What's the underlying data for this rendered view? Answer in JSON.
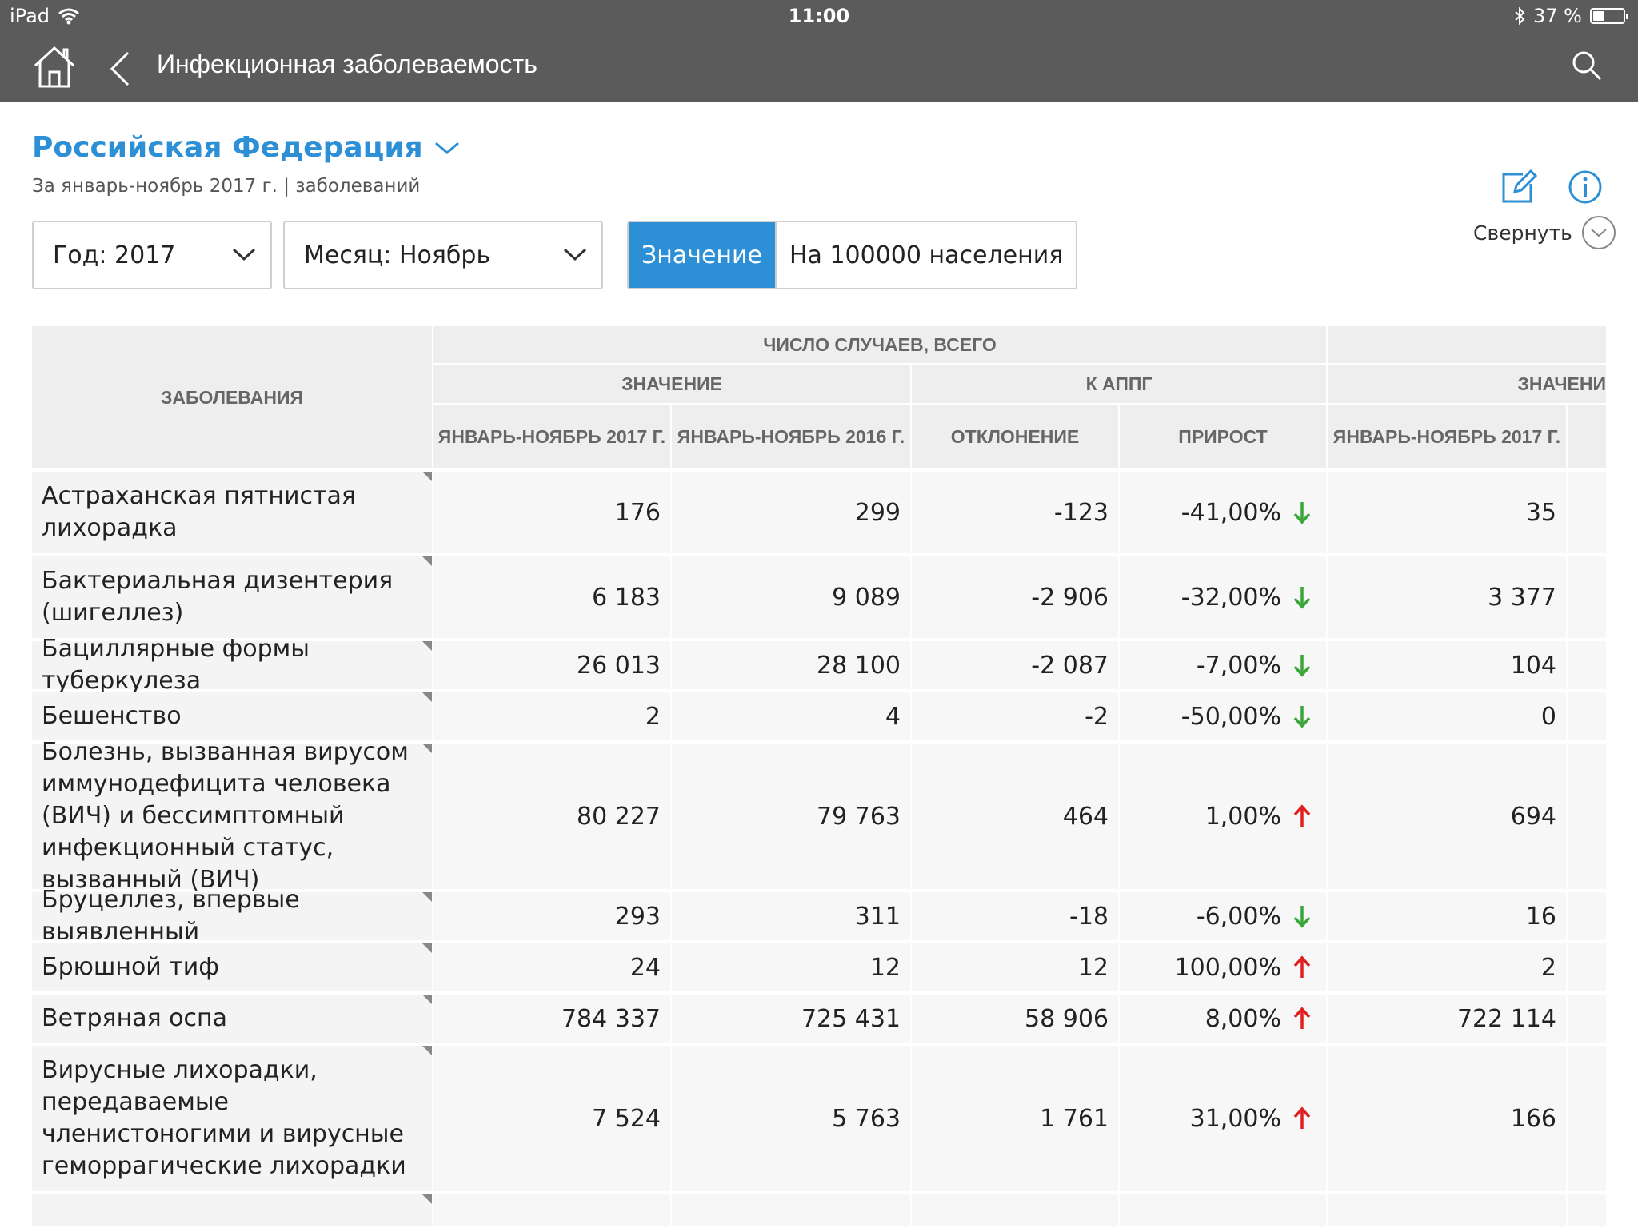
{
  "status_bar": {
    "device": "iPad",
    "time": "11:00",
    "battery": "37 %"
  },
  "nav": {
    "title": "Инфекционная заболеваемость"
  },
  "header": {
    "region": "Российская Федерация",
    "subtitle": "За январь-ноябрь 2017 г. | заболеваний",
    "collapse_label": "Свернуть"
  },
  "filters": {
    "year": "Год: 2017",
    "month": "Месяц: Ноябрь",
    "toggle_value": "Значение",
    "toggle_per100k": "На 100000 населения",
    "toggle_selected": "Значение"
  },
  "table": {
    "col_diseases": "ЗАБОЛЕВАНИЯ",
    "group_total": "ЧИСЛО СЛУЧАЕВ, ВСЕГО",
    "sub_value": "ЗНАЧЕНИЕ",
    "sub_appg": "К АППГ",
    "sub_value2": "ЗНАЧЕНИ",
    "cols": [
      "ЯНВАРЬ-НОЯБРЬ 2017 Г.",
      "ЯНВАРЬ-НОЯБРЬ 2016 Г.",
      "ОТКЛОНЕНИЕ",
      "ПРИРОСТ",
      "ЯНВАРЬ-НОЯБРЬ 2017 Г."
    ],
    "rows": [
      {
        "name": "Астраханская пятнистая лихорадка",
        "v2017": "176",
        "v2016": "299",
        "dev": "-123",
        "growth": "-41,00%",
        "trend": "down",
        "v2": "35"
      },
      {
        "name": "Бактериальная дизентерия (шигеллез)",
        "v2017": "6 183",
        "v2016": "9 089",
        "dev": "-2 906",
        "growth": "-32,00%",
        "trend": "down",
        "v2": "3 377"
      },
      {
        "name": "Бациллярные формы туберкулеза",
        "v2017": "26 013",
        "v2016": "28 100",
        "dev": "-2 087",
        "growth": "-7,00%",
        "trend": "down",
        "v2": "104"
      },
      {
        "name": "Бешенство",
        "v2017": "2",
        "v2016": "4",
        "dev": "-2",
        "growth": "-50,00%",
        "trend": "down",
        "v2": "0"
      },
      {
        "name": "Болезнь, вызванная вирусом иммунодефицита человека (ВИЧ) и бессимптомный инфекционный статус, вызванный (ВИЧ)",
        "v2017": "80 227",
        "v2016": "79 763",
        "dev": "464",
        "growth": "1,00%",
        "trend": "up",
        "v2": "694"
      },
      {
        "name": "Бруцеллез, впервые выявленный",
        "v2017": "293",
        "v2016": "311",
        "dev": "-18",
        "growth": "-6,00%",
        "trend": "down",
        "v2": "16"
      },
      {
        "name": "Брюшной тиф",
        "v2017": "24",
        "v2016": "12",
        "dev": "12",
        "growth": "100,00%",
        "trend": "up",
        "v2": "2"
      },
      {
        "name": "Ветряная оспа",
        "v2017": "784 337",
        "v2016": "725 431",
        "dev": "58 906",
        "growth": "8,00%",
        "trend": "up",
        "v2": "722 114"
      },
      {
        "name": "Вирусные лихорадки, передаваемые членистоногими и вирусные геморрагические лихорадки",
        "v2017": "7 524",
        "v2016": "5 763",
        "dev": "1 761",
        "growth": "31,00%",
        "trend": "up",
        "v2": "166"
      }
    ]
  },
  "colors": {
    "accent": "#2d8fd5",
    "nav_bg": "#5b5b5b",
    "down": "#3aa63a",
    "up": "#e02020"
  }
}
